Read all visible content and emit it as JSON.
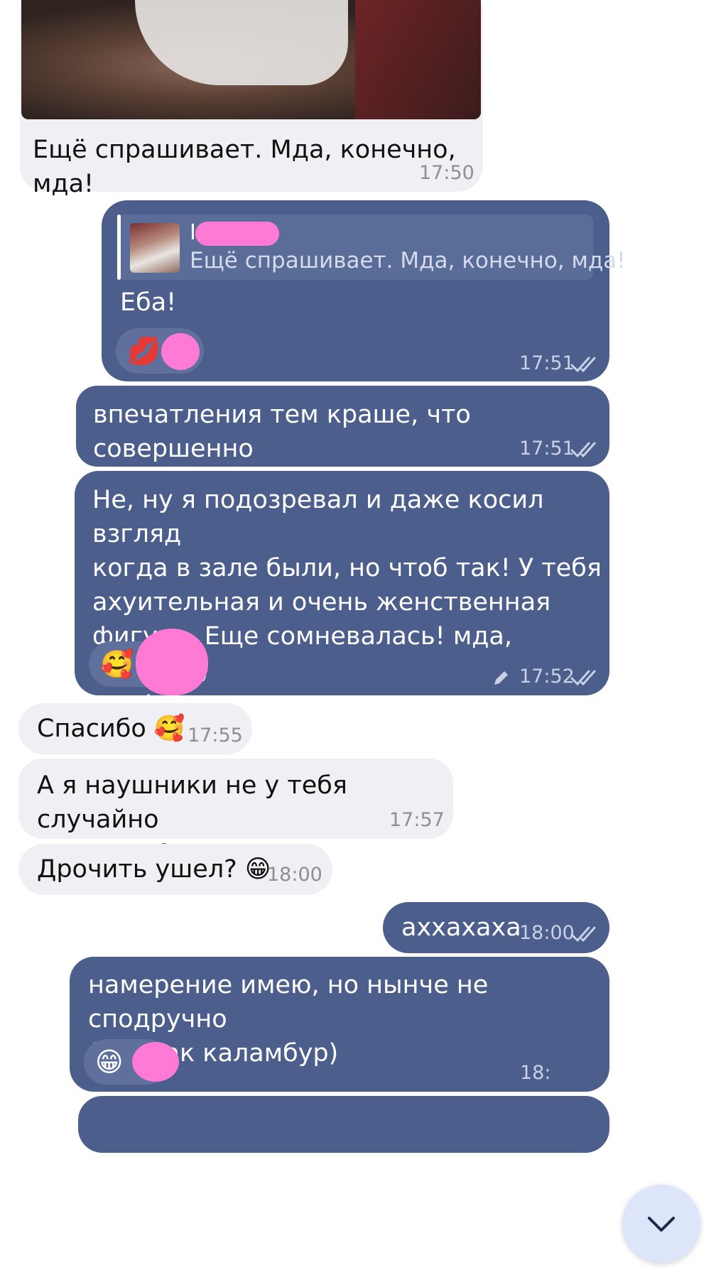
{
  "messages": [
    {
      "id": "m1",
      "direction": "in",
      "has_photo": true,
      "text": "Ещё спрашивает. Мда, конечно, мда!",
      "time": "17:50"
    },
    {
      "id": "m2",
      "direction": "out",
      "reply": {
        "author_initial": "I",
        "text": "Ещё спрашивает. Мда, конечно, мда!"
      },
      "text": "Еба!",
      "reaction_emoji": "💋",
      "time": "17:51",
      "status": "read"
    },
    {
      "id": "m3",
      "direction": "out",
      "text": "впечатления тем краше, что совершенно\nнеожиданно",
      "time": "17:51",
      "status": "read"
    },
    {
      "id": "m4",
      "direction": "out",
      "text": "Не, ну я подозревал и даже косил взгляд\nкогда в зале были, но чтоб так! У тебя\nахуительная и очень женственная\nфигура. Еще сомневалась! мда, конечно,\nмда!",
      "reaction_emoji": "🥰",
      "edited_icon": "pencil-icon",
      "time": "17:52",
      "status": "read"
    },
    {
      "id": "m5",
      "direction": "in",
      "text": "Спасибо 🥰",
      "time": "17:55"
    },
    {
      "id": "m6",
      "direction": "in",
      "text": "А я наушники не у тебя случайно\nоставила?",
      "time": "17:57"
    },
    {
      "id": "m7",
      "direction": "in",
      "text": "Дрочить ушел? 😁",
      "time": "18:00"
    },
    {
      "id": "m8",
      "direction": "out",
      "text": "аххахаха",
      "time": "18:00",
      "status": "read"
    },
    {
      "id": "m9",
      "direction": "out",
      "text": "намерение имею, но нынче не сподручно\n(вот так каламбур)",
      "reaction_emoji": "😁",
      "time": "18:"
    }
  ],
  "scroll_button": {
    "icon": "chevron-down-icon"
  },
  "colors": {
    "incoming_bubble": "#efeff4",
    "outgoing_bubble": "#4b5e8c",
    "redaction_blob": "#ff7ad5",
    "scroll_button": "#dde5fb"
  }
}
